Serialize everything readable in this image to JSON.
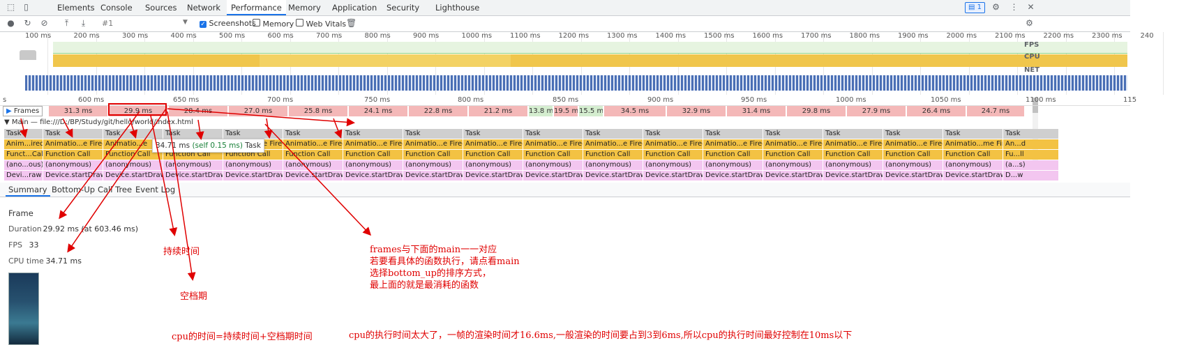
{
  "devtools_tabs": [
    "Elements",
    "Console",
    "Sources",
    "Network",
    "Performance",
    "Memory",
    "Application",
    "Security",
    "Lighthouse"
  ],
  "active_tab": "Performance",
  "badge_count": "1",
  "toolbar": {
    "profile_select": "#1",
    "screenshots_label": "Screenshots",
    "screenshots_checked": true,
    "memory_label": "Memory",
    "memory_checked": false,
    "webvitals_label": "Web Vitals",
    "webvitals_checked": false
  },
  "overview_ticks": [
    "100 ms",
    "200 ms",
    "300 ms",
    "400 ms",
    "500 ms",
    "600 ms",
    "700 ms",
    "800 ms",
    "900 ms",
    "1000 ms",
    "1100 ms",
    "1200 ms",
    "1300 ms",
    "1400 ms",
    "1500 ms",
    "1600 ms",
    "1700 ms",
    "1800 ms",
    "1900 ms",
    "2000 ms",
    "2100 ms",
    "2200 ms",
    "2300 ms",
    "240"
  ],
  "overview_labels": {
    "fps": "FPS",
    "cpu": "CPU",
    "net": "NET"
  },
  "detail_ticks": [
    "s",
    "600 ms",
    "650 ms",
    "700 ms",
    "750 ms",
    "800 ms",
    "850 ms",
    "900 ms",
    "950 ms",
    "1000 ms",
    "1050 ms",
    "1100 ms",
    "115"
  ],
  "frames_label": "Frames",
  "frames": [
    {
      "label": "31.3 ms",
      "color": "red"
    },
    {
      "label": "29.9 ms",
      "color": "red"
    },
    {
      "label": "28.4 ms",
      "color": "red"
    },
    {
      "label": "27.0 ms",
      "color": "red"
    },
    {
      "label": "25.8 ms",
      "color": "red"
    },
    {
      "label": "24.1 ms",
      "color": "red"
    },
    {
      "label": "22.8 ms",
      "color": "red"
    },
    {
      "label": "21.2 ms",
      "color": "red"
    },
    {
      "label": "13.8 ms",
      "color": "green"
    },
    {
      "label": "19.5 ms",
      "color": "red"
    },
    {
      "label": "15.5 ms",
      "color": "green"
    },
    {
      "label": "34.5 ms",
      "color": "red"
    },
    {
      "label": "32.9 ms",
      "color": "red"
    },
    {
      "label": "31.4 ms",
      "color": "red"
    },
    {
      "label": "29.8 ms",
      "color": "red"
    },
    {
      "label": "27.9 ms",
      "color": "red"
    },
    {
      "label": "26.4 ms",
      "color": "red"
    },
    {
      "label": "24.7 ms",
      "color": "red"
    }
  ],
  "main_label": "▼ Main — file:///D:/BP/Study/git/hello/world/index.html",
  "flame_columns": [
    {
      "task": "Task",
      "l1": "Anim...ired",
      "l2": "Funct...Call",
      "l3": "(ano...ous)",
      "l4": "Devi...raw"
    },
    {
      "task": "Task",
      "l1": "Animatio...e Fired",
      "l2": "Function Call",
      "l3": "(anonymous)",
      "l4": "Device.startDraw"
    },
    {
      "task": "Task",
      "l1": "Animatio...e",
      "l2": "Function Call",
      "l3": "(anonymous)",
      "l4": "Device.startDraw"
    },
    {
      "task": "Task",
      "l1": "Animatio...e Fired",
      "l2": "Function Call",
      "l3": "(anonymous)",
      "l4": "Device.startDraw"
    },
    {
      "task": "Task",
      "l1": "Animatio...e Fired",
      "l2": "Function Call",
      "l3": "(anonymous)",
      "l4": "Device.startDraw"
    },
    {
      "task": "Task",
      "l1": "Animatio...e Fired",
      "l2": "Function Call",
      "l3": "(anonymous)",
      "l4": "Device.startDraw"
    },
    {
      "task": "Task",
      "l1": "Animatio...e Fired",
      "l2": "Function Call",
      "l3": "(anonymous)",
      "l4": "Device.startDraw"
    },
    {
      "task": "Task",
      "l1": "Animatio...e Fired",
      "l2": "Function Call",
      "l3": "(anonymous)",
      "l4": "Device.startDraw"
    },
    {
      "task": "Task",
      "l1": "Animatio...e Fired",
      "l2": "Function Call",
      "l3": "(anonymous)",
      "l4": "Device.startDraw"
    },
    {
      "task": "Task",
      "l1": "Animatio...e Fired",
      "l2": "Function Call",
      "l3": "(anonymous)",
      "l4": "Device.startDraw"
    },
    {
      "task": "Task",
      "l1": "Animatio...e Fired",
      "l2": "Function Call",
      "l3": "(anonymous)",
      "l4": "Device.startDraw"
    },
    {
      "task": "Task",
      "l1": "Animatio...e Fired",
      "l2": "Function Call",
      "l3": "(anonymous)",
      "l4": "Device.startDraw"
    },
    {
      "task": "Task",
      "l1": "Animatio...e Fired",
      "l2": "Function Call",
      "l3": "(anonymous)",
      "l4": "Device.startDraw"
    },
    {
      "task": "Task",
      "l1": "Animatio...e Fired",
      "l2": "Function Call",
      "l3": "(anonymous)",
      "l4": "Device.startDraw"
    },
    {
      "task": "Task",
      "l1": "Animatio...e Fired",
      "l2": "Function Call",
      "l3": "(anonymous)",
      "l4": "Device.startDraw"
    },
    {
      "task": "Task",
      "l1": "Animatio...e Fired",
      "l2": "Function Call",
      "l3": "(anonymous)",
      "l4": "Device.startDraw"
    },
    {
      "task": "Task",
      "l1": "Animatio...me Fired",
      "l2": "Function Call",
      "l3": "(anonymous)",
      "l4": "Device.startDraw"
    },
    {
      "task": "Task",
      "l1": "An...d",
      "l2": "Fu...ll",
      "l3": "(a...s)",
      "l4": "D...w"
    }
  ],
  "tooltip": {
    "time": "34.71 ms",
    "self": "(self 0.15 ms)",
    "name": "Task"
  },
  "bottom_tabs": [
    "Summary",
    "Bottom-Up",
    "Call Tree",
    "Event Log"
  ],
  "summary": {
    "title": "Frame",
    "duration_label": "Duration",
    "duration_value": "29.92 ms (at 603.46 ms)",
    "fps_label": "FPS",
    "fps_value": "33",
    "cpu_label": "CPU time",
    "cpu_value": "34.71 ms"
  },
  "annotations": {
    "duration": "持续时间",
    "idle": "空档期",
    "cpu_formula": "cpu的时间=持续时间+空档期时间",
    "frames_note": [
      "frames与下面的main一一对应",
      "若要看具体的函数执行，请点看main",
      "选择bottom_up的排序方式，",
      "最上面的就是最消耗的函数"
    ],
    "cpu_note": "cpu的执行时间太大了，一帧的渲染时间才16.6ms,一般渲染的时间要占到3到6ms,所以cpu的执行时间最好控制在10ms以下"
  },
  "colors": {
    "annotation": "#e00000",
    "accent": "#1a73e8",
    "frame_red": "#f4b8b8",
    "frame_green": "#d4edcf",
    "task_gray": "#cfcfcf",
    "script_yellow": "#f3c243",
    "pink": "#f3c6f0"
  }
}
